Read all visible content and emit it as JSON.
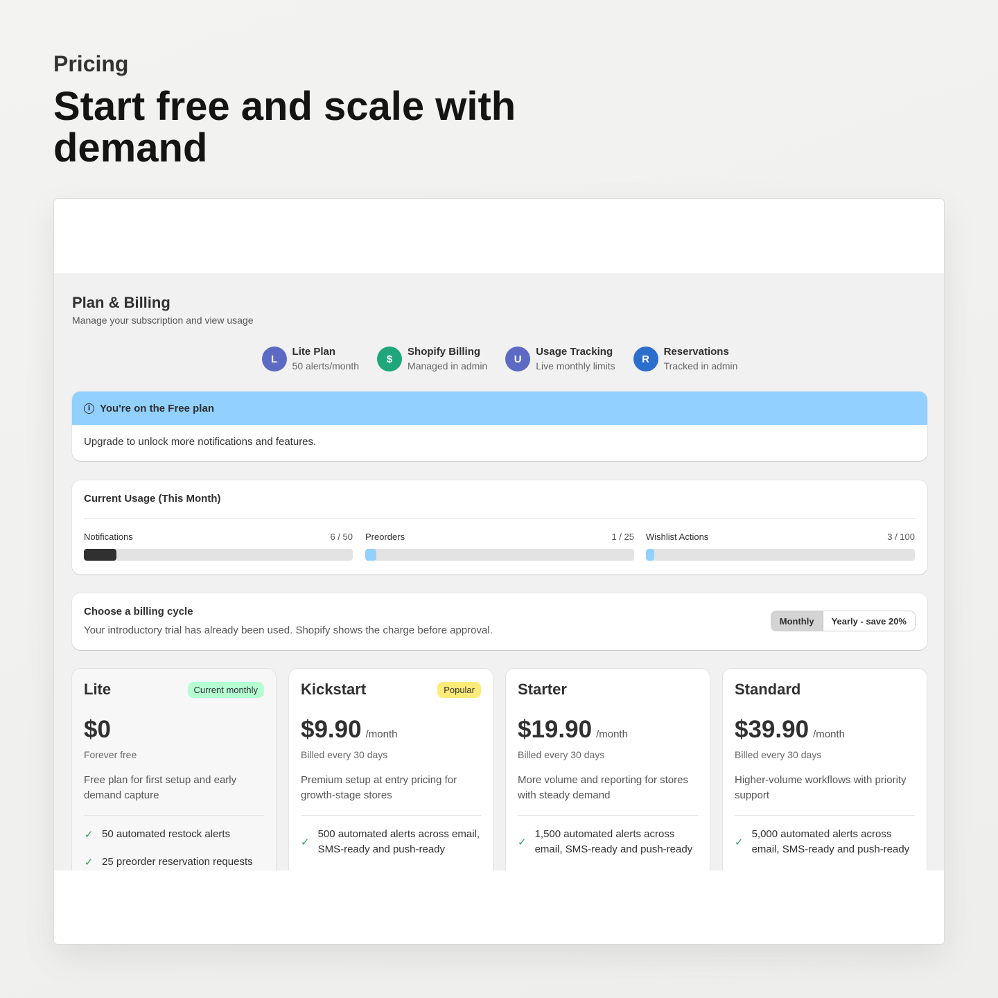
{
  "hero": {
    "eyebrow": "Pricing",
    "title": "Start free and scale with demand"
  },
  "page": {
    "title": "Plan & Billing",
    "subtitle": "Manage your subscription and view usage"
  },
  "features": [
    {
      "letter": "L",
      "title": "Lite Plan",
      "sub": "50 alerts/month",
      "color": "#5c6ac4"
    },
    {
      "letter": "$",
      "title": "Shopify Billing",
      "sub": "Managed in admin",
      "color": "#1fa67a"
    },
    {
      "letter": "U",
      "title": "Usage Tracking",
      "sub": "Live monthly limits",
      "color": "#5c6ac4"
    },
    {
      "letter": "R",
      "title": "Reservations",
      "sub": "Tracked in admin",
      "color": "#2c6ecb"
    }
  ],
  "banner": {
    "title": "You're on the Free plan",
    "body": "Upgrade to unlock more notifications and features."
  },
  "usage": {
    "title": "Current Usage (This Month)",
    "meters": [
      {
        "label": "Notifications",
        "value": "6 / 50",
        "fraction": 0.12,
        "color": "#303030"
      },
      {
        "label": "Preorders",
        "value": "1 / 25",
        "fraction": 0.04,
        "color": "#91d0ff"
      },
      {
        "label": "Wishlist Actions",
        "value": "3 / 100",
        "fraction": 0.03,
        "color": "#91d0ff"
      }
    ]
  },
  "cycle": {
    "title": "Choose a billing cycle",
    "subtitle": "Your introductory trial has already been used. Shopify shows the charge before approval.",
    "monthly": "Monthly",
    "yearly": "Yearly - save 20%",
    "selected": "Monthly"
  },
  "plans": [
    {
      "name": "Lite",
      "badge": "Current monthly",
      "badge_color": "#b4fed2",
      "price": "$0",
      "per": "",
      "billed": "Forever free",
      "desc": "Free plan for first setup and early demand capture",
      "features": [
        "50 automated restock alerts",
        "25 preorder reservation requests"
      ]
    },
    {
      "name": "Kickstart",
      "badge": "Popular",
      "badge_color": "#ffeb78",
      "price": "$9.90",
      "per": "/month",
      "billed": "Billed every 30 days",
      "desc": "Premium setup at entry pricing for growth-stage stores",
      "features": [
        "500 automated alerts across email, SMS-ready and push-ready"
      ]
    },
    {
      "name": "Starter",
      "badge": "",
      "badge_color": "",
      "price": "$19.90",
      "per": "/month",
      "billed": "Billed every 30 days",
      "desc": "More volume and reporting for stores with steady demand",
      "features": [
        "1,500 automated alerts across email, SMS-ready and push-ready"
      ]
    },
    {
      "name": "Standard",
      "badge": "",
      "badge_color": "",
      "price": "$39.90",
      "per": "/month",
      "billed": "Billed every 30 days",
      "desc": "Higher-volume workflows with priority support",
      "features": [
        "5,000 automated alerts across email, SMS-ready and push-ready"
      ]
    }
  ]
}
